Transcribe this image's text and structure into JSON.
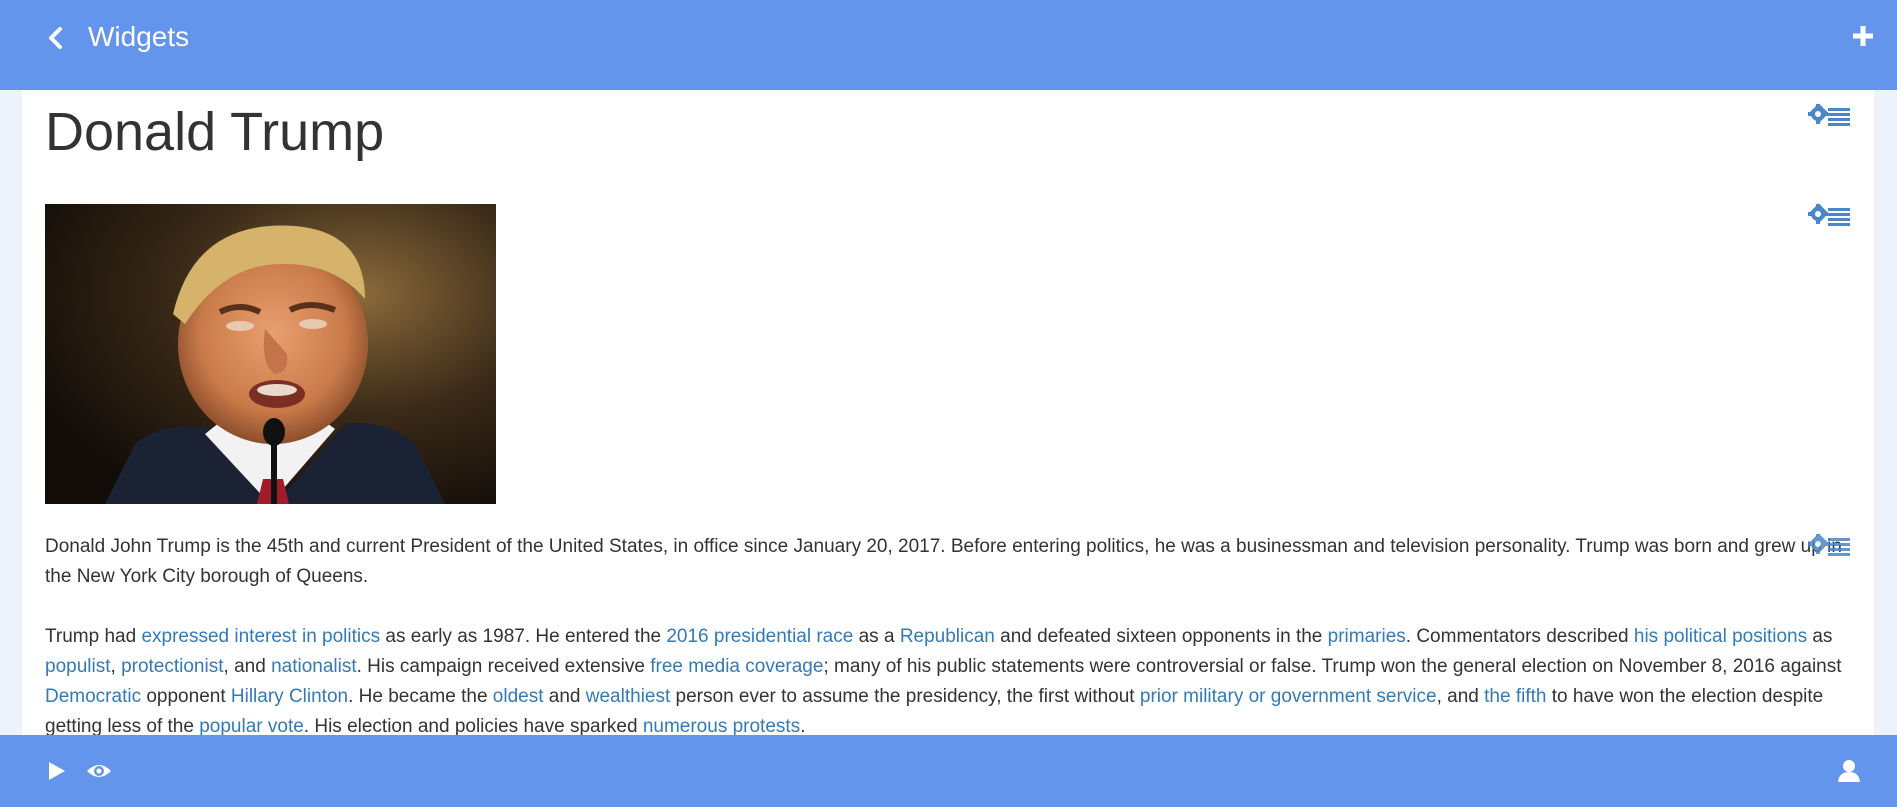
{
  "header": {
    "title": "Widgets",
    "back_icon": "chevron-left-icon",
    "add_icon": "plus-icon"
  },
  "page": {
    "heading": "Donald Trump",
    "settings_icon": "gear-list-icon"
  },
  "image": {
    "subject": "portrait photo of Donald Trump speaking at a microphone"
  },
  "paragraph1": "Donald John Trump is the 45th and current President of the United States, in office since January 20, 2017. Before entering politics, he was a businessman and television personality. Trump was born and grew up in the New York City borough of Queens.",
  "paragraph2": {
    "t0": "Trump had ",
    "l0": "expressed interest in politics",
    "t1": " as early as 1987. He entered the ",
    "l1": "2016 presidential race",
    "t2": " as a ",
    "l2": "Republican",
    "t3": " and defeated sixteen opponents in the ",
    "l3": "primaries",
    "t4": ". Commentators described ",
    "l4": "his political positions",
    "t5": " as ",
    "l5": "populist",
    "t6": ", ",
    "l6": "protectionist",
    "t7": ", and ",
    "l7": "nationalist",
    "t8": ". His campaign received extensive ",
    "l8": "free media coverage",
    "t9": "; many of his public statements were controversial or false. Trump won the general election on November 8, 2016 against ",
    "l9": "Democratic",
    "t10": " opponent ",
    "l10": "Hillary Clinton",
    "t11": ". He became the ",
    "l11": "oldest",
    "t12": " and ",
    "l12": "wealthiest",
    "t13": " person ever to assume the presidency, the first without ",
    "l13": "prior military or government service",
    "t14": ", and ",
    "l14": "the fifth",
    "t15": " to have won the election despite getting less of the ",
    "l15": "popular vote",
    "t16": ". His election and policies have sparked ",
    "l16": "numerous protests",
    "t17": "."
  },
  "footer": {
    "play_icon": "play-icon",
    "preview_icon": "eye-icon",
    "user_icon": "user-icon"
  },
  "colors": {
    "bar": "#6495ed",
    "link": "#337ab7",
    "settings": "#4a86c8"
  }
}
